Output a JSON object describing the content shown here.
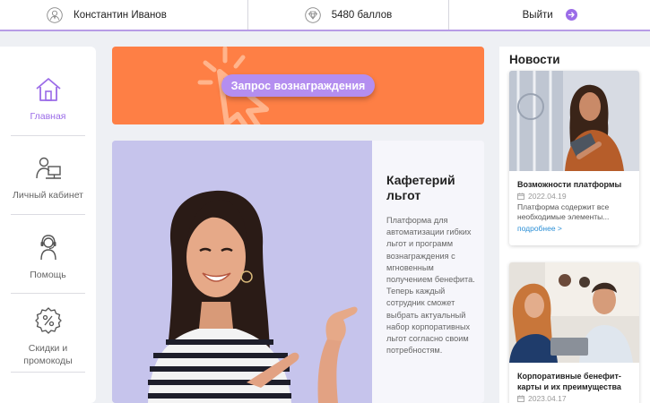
{
  "topbar": {
    "user_name": "Константин Иванов",
    "points": "5480 баллов",
    "logout": "Выйти"
  },
  "sidebar": {
    "items": [
      {
        "label": "Главная",
        "icon": "home-icon",
        "active": true
      },
      {
        "label": "Личный кабинет",
        "icon": "user-desk-icon",
        "active": false
      },
      {
        "label": "Помощь",
        "icon": "headset-icon",
        "active": false
      },
      {
        "label": "Скидки и промокоды",
        "icon": "discount-icon",
        "active": false
      }
    ]
  },
  "promo": {
    "button_label": "Запрос вознаграждения"
  },
  "cafeteria": {
    "title": "Кафетерий льгот",
    "description": "Платформа для автоматизации гибких льгот и программ вознаграждения с мгновенным получением бенефита. Теперь каждый сотрудник сможет выбрать актуальный набор корпоративных льгот согласно своим потребностям."
  },
  "news": {
    "header": "Новости",
    "items": [
      {
        "title": "Возможности платформы",
        "date": "2022.04.19",
        "description": "Платформа содержит все необходимые элементы...",
        "more": "подробнее >"
      },
      {
        "title": "Корпоративные бенефит-карты и их преимущества",
        "date": "2023.04.17"
      }
    ]
  },
  "colors": {
    "accent": "#9b6ce8",
    "promo_bg": "#fe7f45",
    "promo_button": "#b48ef0",
    "card_image_bg": "#c6c4ec",
    "link": "#2b8fd6"
  }
}
